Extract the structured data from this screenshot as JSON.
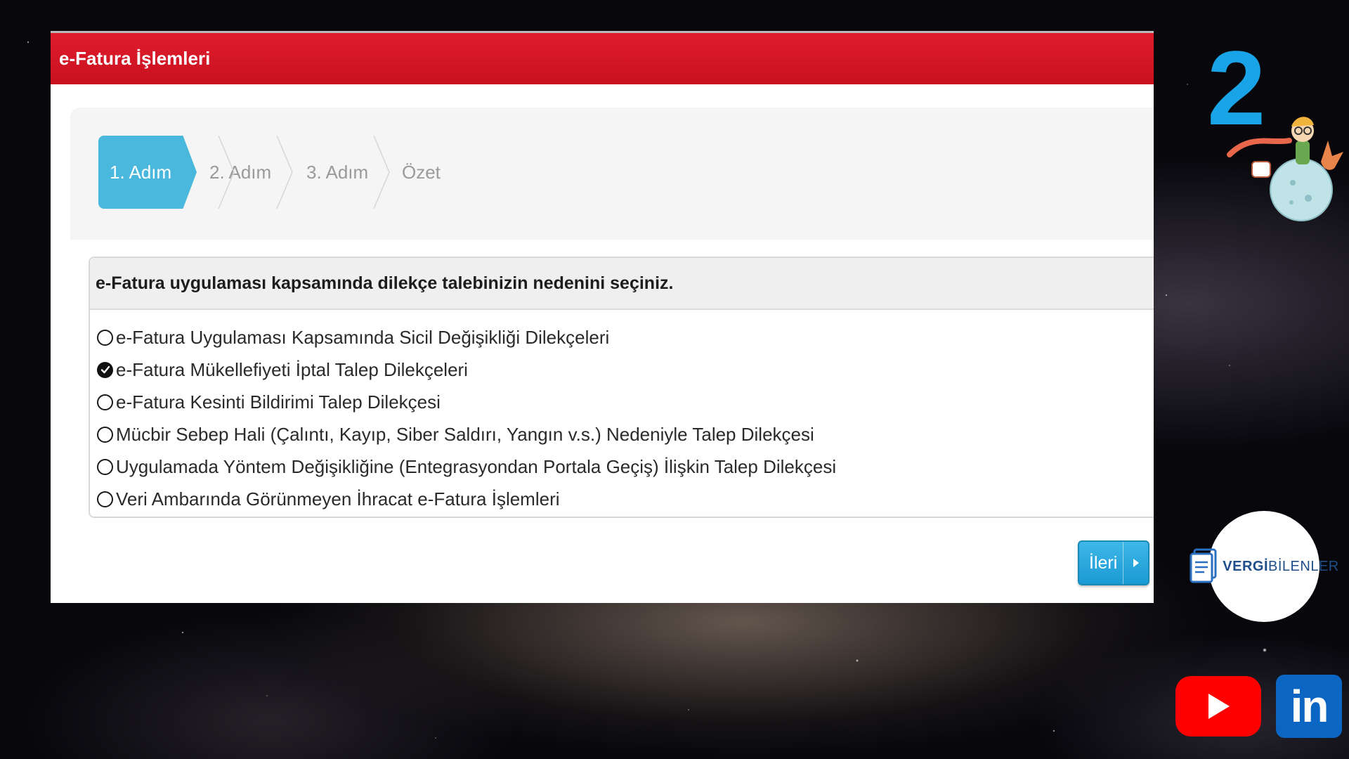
{
  "window": {
    "title": "e-Fatura İşlemleri"
  },
  "wizard": {
    "steps": [
      {
        "label": "1. Adım",
        "active": true
      },
      {
        "label": "2. Adım",
        "active": false
      },
      {
        "label": "3. Adım",
        "active": false
      },
      {
        "label": "Özet",
        "active": false
      }
    ]
  },
  "question": {
    "prompt": "e-Fatura uygulaması kapsamında dilekçe talebinizin nedenini seçiniz.",
    "options": [
      {
        "label": "e-Fatura Uygulaması Kapsamında Sicil Değişikliği Dilekçeleri",
        "selected": false
      },
      {
        "label": "e-Fatura Mükellefiyeti İptal Talep Dilekçeleri",
        "selected": true
      },
      {
        "label": "e-Fatura Kesinti Bildirimi Talep Dilekçesi",
        "selected": false
      },
      {
        "label": "Mücbir Sebep Hali (Çalıntı, Kayıp, Siber Saldırı, Yangın v.s.) Nedeniyle Talep Dilekçesi",
        "selected": false
      },
      {
        "label": "Uygulamada Yöntem Değişikliğine (Entegrasyondan Portala Geçiş) İlişkin Talep Dilekçesi",
        "selected": false
      },
      {
        "label": "Veri Ambarında Görünmeyen İhracat e-Fatura İşlemleri",
        "selected": false
      }
    ]
  },
  "next_button": {
    "label": "İleri"
  },
  "overlay": {
    "step_number": "2",
    "brand_bold": "VERGİ",
    "brand_rest": "BİLENLER",
    "linkedin_label": "in"
  },
  "colors": {
    "title_bar": "#d0121f",
    "active_step": "#4ab8dd",
    "next_button": "#1a9ad3",
    "step_number": "#1aa4e8",
    "youtube": "#ff0000",
    "linkedin": "#0a66c2"
  },
  "icons": [
    "radio-unchecked-icon",
    "radio-checked-icon",
    "chevron-right-icon",
    "youtube-icon",
    "linkedin-icon",
    "document-icon"
  ]
}
